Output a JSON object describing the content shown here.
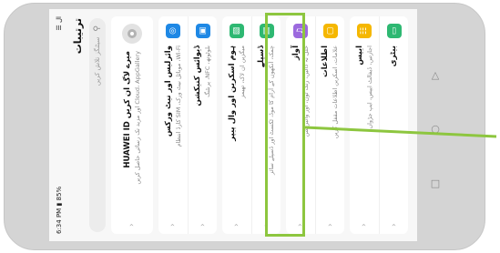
{
  "status": {
    "time": "6:34 PM",
    "battery": "85%",
    "signal": "ال"
  },
  "header": {
    "title": "ترتیبات"
  },
  "search": {
    "placeholder": "سیٹنگز تلاش کریں"
  },
  "account": {
    "title": "میرے لاگ ان کریں HUAWEI ID",
    "subtitle": "Cloud، AppGallery اور مزید تک رسائی حاصل کریں"
  },
  "settings_rows": [
    {
      "group": 1,
      "title": "وائرلیس اور نیٹ ورکس",
      "subtitle": "Wi-Fi، موبائل نیٹ ورک، SIM کارڈ انتظام",
      "icon": "wifi-icon",
      "color": "#1e88e5",
      "glyph": "◎"
    },
    {
      "group": 1,
      "title": "ڈیوائس کنیکشن",
      "subtitle": "بلوٹوتھ، NFC، پرنٹنگ",
      "icon": "device-connection-icon",
      "color": "#1e88e5",
      "glyph": "▣"
    },
    {
      "group": 2,
      "title": "ہوم اسکرین اور وال پیپر",
      "subtitle": "میگزین ان لاک، تھیمز",
      "icon": "home-screen-icon",
      "color": "#2eb872",
      "glyph": "▧"
    },
    {
      "group": 2,
      "title": "ڈسپلے",
      "subtitle": "چمک، آنکھوں کے آرام کا موڈ، ٹکسٹ اور ڈسپلے سائز",
      "icon": "display-icon",
      "color": "#2eb872",
      "glyph": "▤"
    },
    {
      "group": 3,
      "title": "آواز",
      "subtitle": "خلل نہ ڈالیں، رنگ ٹون، اور وائبریشن",
      "icon": "sound-icon",
      "color": "#9c6ade",
      "glyph": "♫"
    },
    {
      "group": 3,
      "title": "اطلاعات",
      "subtitle": "علامات، اسکرین اطلاعات مقفل کریں",
      "icon": "notifications-icon",
      "color": "#f5b700",
      "glyph": "▢"
    },
    {
      "group": 4,
      "title": "ایپس",
      "subtitle": "اجازتیں، ڈیفالٹ ایپس، ایپ جڑواں",
      "icon": "apps-icon",
      "color": "#f5b700",
      "glyph": "☷"
    },
    {
      "group": 4,
      "title": "بیٹری",
      "subtitle": "",
      "icon": "battery-icon",
      "color": "#2eb872",
      "glyph": "▭"
    }
  ],
  "accent_color": "#8dc63f"
}
